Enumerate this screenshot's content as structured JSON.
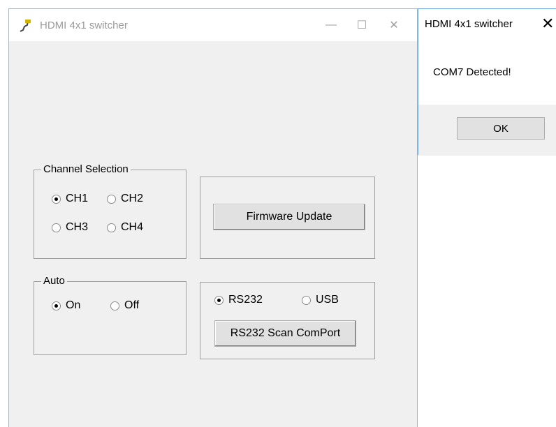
{
  "main_window": {
    "title": "HDMI 4x1 switcher",
    "controls": {
      "minimize": "—",
      "maximize": "☐",
      "close": "✕"
    },
    "channel_selection": {
      "legend": "Channel Selection",
      "options": [
        "CH1",
        "CH2",
        "CH3",
        "CH4"
      ],
      "selected": "CH1"
    },
    "firmware_button": "Firmware Update",
    "auto": {
      "legend": "Auto",
      "options": [
        "On",
        "Off"
      ],
      "selected": "On"
    },
    "connection": {
      "options": [
        "RS232",
        "USB"
      ],
      "selected": "RS232",
      "scan_button": "RS232 Scan ComPort"
    }
  },
  "dialog": {
    "title": "HDMI 4x1 switcher",
    "close": "✕",
    "message": "COM7 Detected!",
    "ok_button": "OK"
  }
}
